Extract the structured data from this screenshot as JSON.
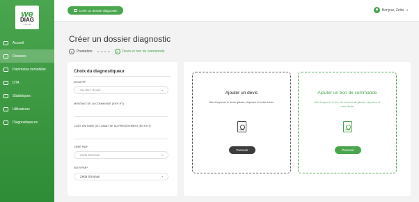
{
  "logo": {
    "brand_top": "we",
    "brand_bottom": "DIAG",
    "brand_sub": "ONLINE"
  },
  "sidebar": {
    "items": [
      {
        "label": "Accueil",
        "icon": "home-icon",
        "active": false
      },
      {
        "label": "Dossiers",
        "icon": "folder-icon",
        "active": true
      },
      {
        "label": "Patrimoine immobilier",
        "icon": "building-icon",
        "active": false
      },
      {
        "label": "DTA",
        "icon": "document-icon",
        "active": false
      },
      {
        "label": "Statistiques",
        "icon": "stats-icon",
        "active": false
      },
      {
        "label": "Utilisateurs",
        "icon": "users-icon",
        "active": false
      },
      {
        "label": "Diagnostiqueurs",
        "icon": "diagnostician-icon",
        "active": false
      }
    ]
  },
  "topbar": {
    "create_label": "Créer un dossier diagnostic",
    "greeting": "Bonjour, Zetta"
  },
  "page": {
    "title": "Créer un dossier diagnostic",
    "steps": [
      {
        "num": "1",
        "label": "Prestation",
        "current": false
      },
      {
        "num": "2",
        "label": "Devis et bon de commande",
        "current": true
      }
    ]
  },
  "form": {
    "title": "Choix du diagnostiqueur",
    "societe_label": "SOCIÉTÉ*",
    "societe_placeholder": "Veuillez choisir ...",
    "montant_label": "MONTANT DE LA COMMANDE (EN € HT)",
    "cout_label": "COÛT UNITAIRE DE L'ANALYSE DU PRÉLÈVEMENT (EN € HT)",
    "cree_label": "CRÉÉ PAR*",
    "cree_value": "Zetta Stroman",
    "suivi_label": "SUIVI PAR*",
    "suivi_value": "Zetta Stroman"
  },
  "uploads": {
    "devis": {
      "title": "Ajouter un devis",
      "desc": "Afin d'importer le devis glissez, déposez ici votre fichier",
      "button": "Parcourir"
    },
    "bon": {
      "title": "Ajouter un bon de commande",
      "desc": "Afin d'importer le bon de commande glissez, déposez ici votre fichier",
      "button": "Parcourir"
    }
  },
  "colors": {
    "accent": "#4aa64e",
    "dark_button": "#3d3d3d"
  }
}
